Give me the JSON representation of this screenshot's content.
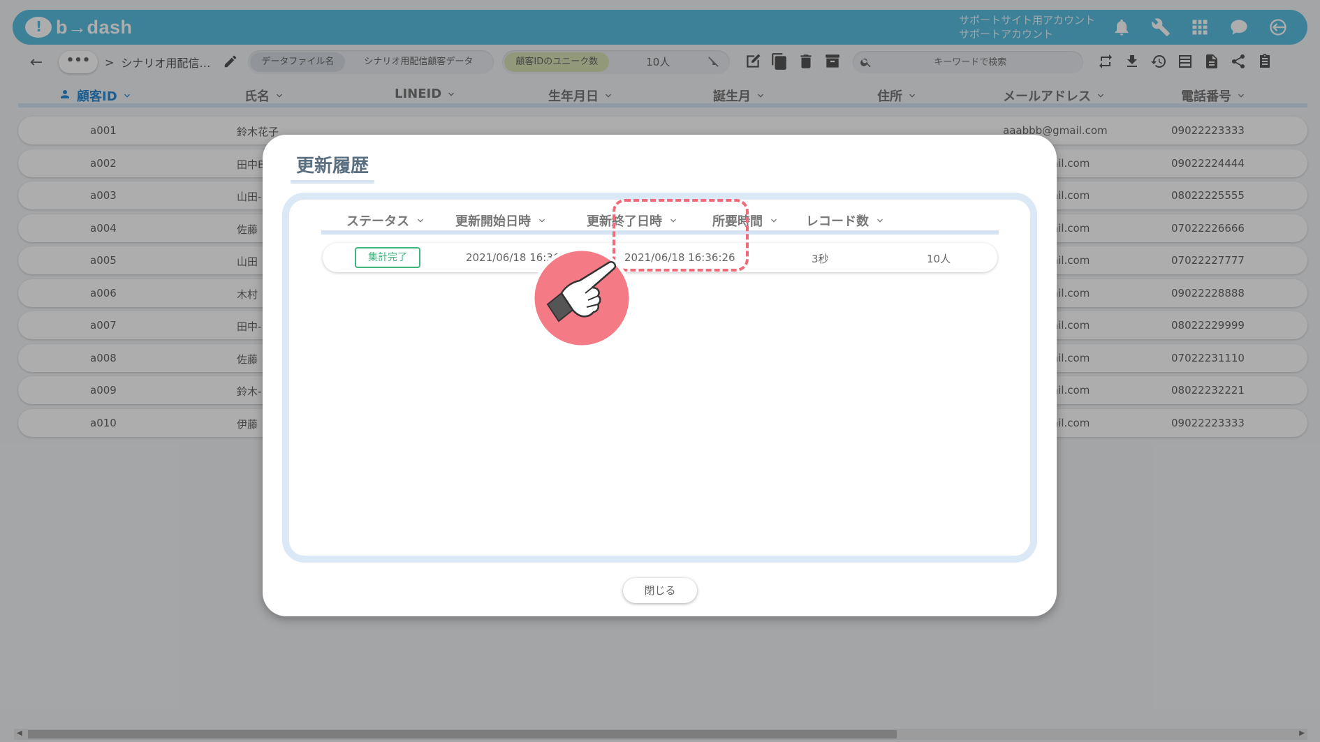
{
  "header": {
    "logo": "b→dash",
    "account_line1": "サポートサイト用アカウント",
    "account_line2": "サポートアカウント",
    "icons": [
      "bell-icon",
      "wrench-icon",
      "grid-icon",
      "chat-icon",
      "logout-icon"
    ],
    "color": "#5bbfe0"
  },
  "toolbar": {
    "back": "←",
    "crumb_dots": "•••",
    "crumb_sep": ">",
    "crumb_name": "シナリオ用配信…",
    "file_label": "データファイル名",
    "file_value": "シナリオ用配信顧客データ",
    "unique_label": "顧客IDのユニーク数",
    "unique_value": "10人",
    "search_placeholder": "キーワードで検索"
  },
  "table": {
    "headers": [
      "顧客ID",
      "氏名",
      "LINEID",
      "生年月日",
      "誕生月",
      "住所",
      "メールアドレス",
      "電話番号"
    ],
    "rows": [
      {
        "id": "a001",
        "name": "鈴木花子",
        "email": "aaabbb@gmail.com",
        "phone": "09022223333"
      },
      {
        "id": "a002",
        "name": "田中B",
        "email": "ail.com",
        "phone": "09022224444"
      },
      {
        "id": "a003",
        "name": "山田-",
        "email": "ail.com",
        "phone": "08022225555"
      },
      {
        "id": "a004",
        "name": "佐藤",
        "email": "ail.com",
        "phone": "07022226666"
      },
      {
        "id": "a005",
        "name": "山田",
        "email": "ail.com",
        "phone": "07022227777"
      },
      {
        "id": "a006",
        "name": "木村",
        "email": "ail.com",
        "phone": "09022228888"
      },
      {
        "id": "a007",
        "name": "田中-",
        "email": "ail.com",
        "phone": "08022229999"
      },
      {
        "id": "a008",
        "name": "佐藤",
        "email": "ail.com",
        "phone": "07022231110"
      },
      {
        "id": "a009",
        "name": "鈴木-",
        "email": "ail.com",
        "phone": "08022232221"
      },
      {
        "id": "a010",
        "name": "伊藤",
        "email": "ail.com",
        "phone": "09022223333"
      }
    ]
  },
  "modal": {
    "title": "更新履歴",
    "headers": [
      "ステータス",
      "更新開始日時",
      "更新終了日時",
      "所要時間",
      "レコード数"
    ],
    "row": {
      "status": "集計完了",
      "start": "2021/06/18 16:36:2",
      "end": "2021/06/18 16:36:26",
      "duration": "3秒",
      "records": "10人"
    },
    "close_label": "閉じる",
    "highlight_color": "#f06a7a",
    "status_color": "#3bb57c"
  }
}
